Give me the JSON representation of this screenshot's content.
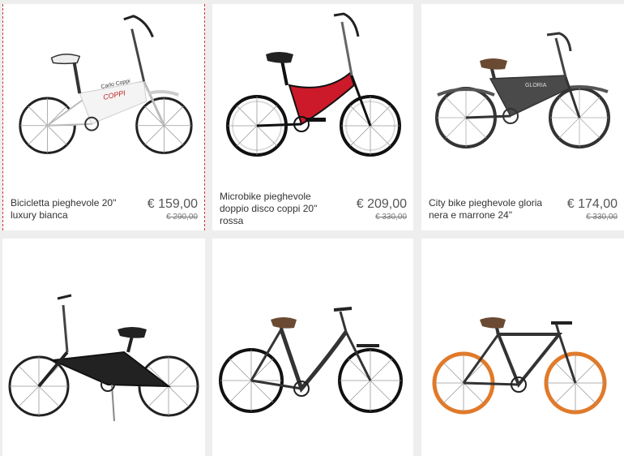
{
  "products": [
    {
      "name": "Bicicletta pieghevole 20\" luxury bianca",
      "price": "€ 159,00",
      "old_price": "€ 290,00"
    },
    {
      "name": "Microbike pieghevole doppio disco coppi 20\" rossa",
      "price": "€ 209,00",
      "old_price": "€ 330,00"
    },
    {
      "name": "City bike pieghevole gloria nera e marrone 24\"",
      "price": "€ 174,00",
      "old_price": "€ 330,00"
    },
    {
      "name": "",
      "price": "",
      "old_price": ""
    },
    {
      "name": "",
      "price": "",
      "old_price": ""
    },
    {
      "name": "",
      "price": "",
      "old_price": ""
    }
  ],
  "bike_labels": {
    "coppi": "COPPI",
    "brand": "Carlo Coppi",
    "gloria": "GLORIA"
  },
  "colors": {
    "red_frame": "#cc1a2a",
    "orange_rims": "#e07a2a",
    "saddle_brown": "#6a4a32"
  }
}
